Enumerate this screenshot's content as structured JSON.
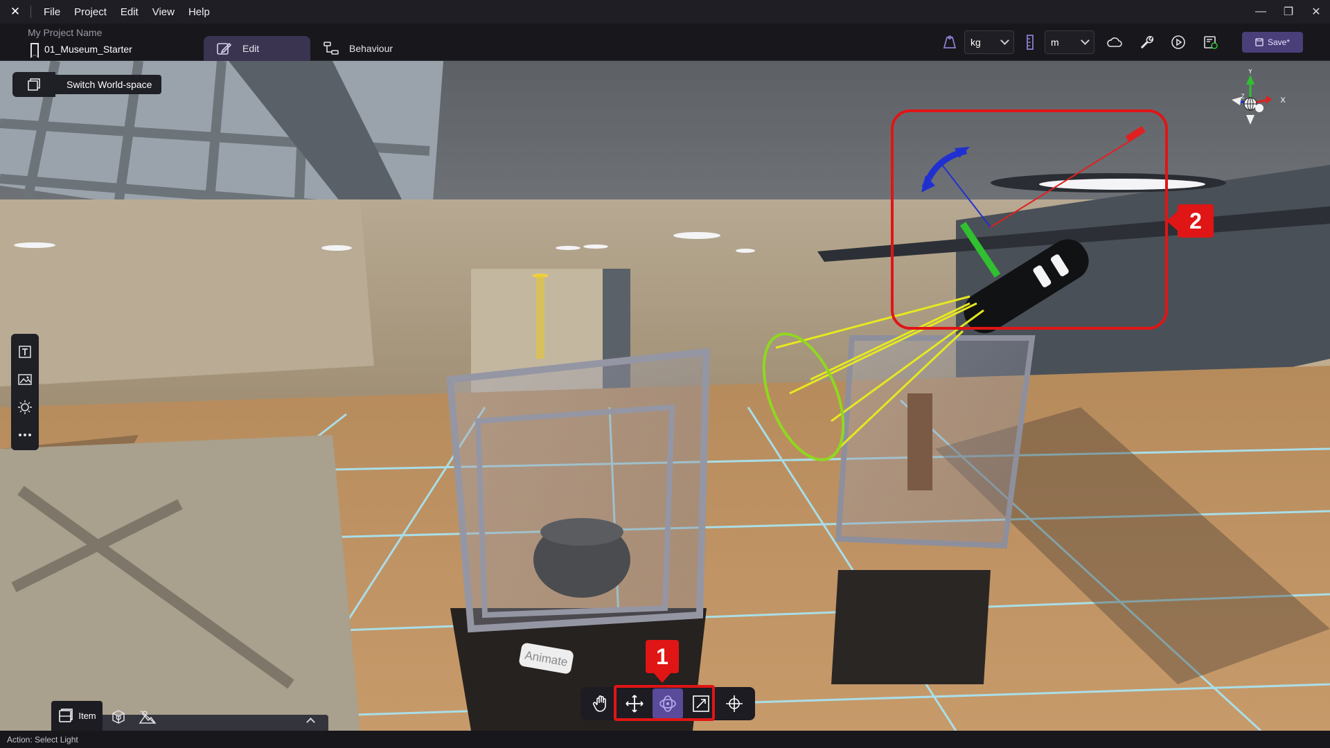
{
  "menu": {
    "items": [
      "File",
      "Project",
      "Edit",
      "View",
      "Help"
    ]
  },
  "project": {
    "name": "My Project Name",
    "scene": "01_Museum_Starter"
  },
  "modes": {
    "edit_label": "Edit",
    "behaviour_label": "Behaviour"
  },
  "units": {
    "mass": "kg",
    "length": "m"
  },
  "save": {
    "label": "Save*"
  },
  "viewport": {
    "switch_world_space_label": "Switch World-space",
    "axis_labels": {
      "x": "X",
      "y": "Y",
      "z": "Z"
    },
    "exhibit_label": "Animate",
    "active_tool": "rotate"
  },
  "callouts": {
    "one": "1",
    "two": "2"
  },
  "bottom_panel": {
    "item_tab_label": "Item"
  },
  "status": {
    "text": "Action: Select Light"
  },
  "colors": {
    "accent": "#5a4a9a",
    "callout": "#e01515",
    "gizmo_x": "#e02020",
    "gizmo_y": "#30c030",
    "gizmo_z": "#2030d0"
  }
}
